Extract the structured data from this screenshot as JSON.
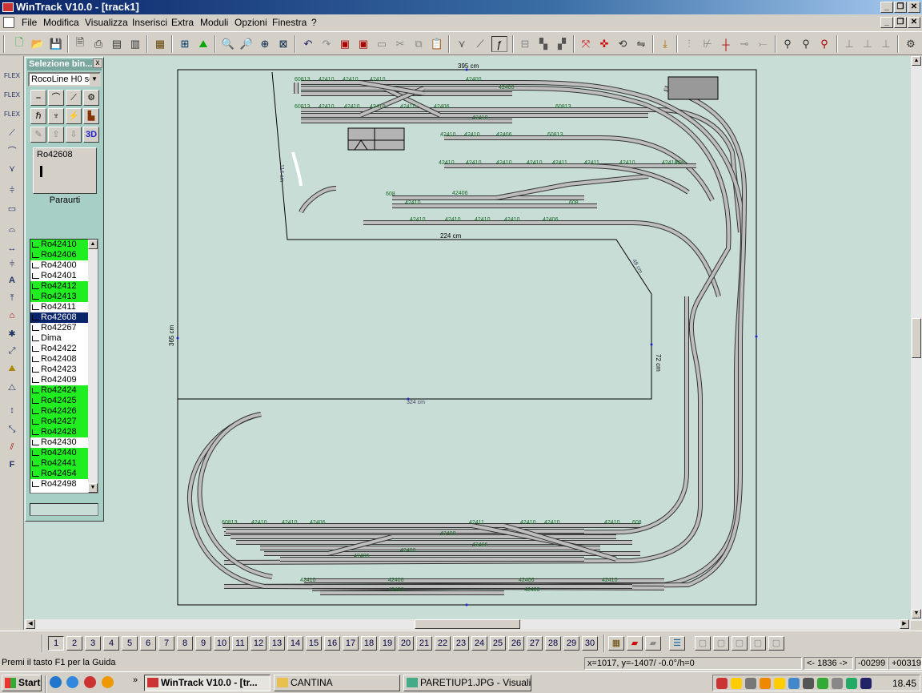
{
  "window": {
    "title": "WinTrack  V10.0 - [track1]",
    "menu": [
      "File",
      "Modifica",
      "Visualizza",
      "Inserisci",
      "Extra",
      "Moduli",
      "Opzioni",
      "Finestra",
      "?"
    ]
  },
  "selector_panel": {
    "title": "Selezione bin...",
    "close_label": "x",
    "system": "RocoLine H0 se",
    "view_3d_label": "3D",
    "preview_code": "Ro42608",
    "preview_caption": "Paraurti",
    "parts": [
      {
        "label": "Ro42410",
        "state": "green"
      },
      {
        "label": "Ro42406",
        "state": "green"
      },
      {
        "label": "Ro42400",
        "state": "normal"
      },
      {
        "label": "Ro42401",
        "state": "normal"
      },
      {
        "label": "Ro42412",
        "state": "green"
      },
      {
        "label": "Ro42413",
        "state": "green"
      },
      {
        "label": "Ro42411",
        "state": "normal"
      },
      {
        "label": "Ro42608",
        "state": "selected"
      },
      {
        "label": "Ro42267",
        "state": "normal"
      },
      {
        "label": "Dima",
        "state": "normal"
      },
      {
        "label": "Ro42422",
        "state": "normal"
      },
      {
        "label": "Ro42408",
        "state": "normal"
      },
      {
        "label": "Ro42423",
        "state": "normal"
      },
      {
        "label": "Ro42409",
        "state": "normal"
      },
      {
        "label": "Ro42424",
        "state": "green"
      },
      {
        "label": "Ro42425",
        "state": "green"
      },
      {
        "label": "Ro42426",
        "state": "green"
      },
      {
        "label": "Ro42427",
        "state": "green"
      },
      {
        "label": "Ro42428",
        "state": "green"
      },
      {
        "label": "Ro42430",
        "state": "normal"
      },
      {
        "label": "Ro42440",
        "state": "green"
      },
      {
        "label": "Ro42441",
        "state": "green"
      },
      {
        "label": "Ro42454",
        "state": "green"
      },
      {
        "label": "Ro42498",
        "state": "normal"
      }
    ]
  },
  "drawing": {
    "dim_top": "395 cm",
    "dim_left": "365 cm",
    "dim_inner_h": "224 cm",
    "dim_inner_v": "72 cm",
    "dim_bottom_inner": "324 cm",
    "dim_small": "114 cm",
    "dim_diag": "48 cm",
    "track_labels": [
      "60813",
      "42410",
      "42410",
      "42410",
      "42400",
      "42400",
      "60813",
      "42410",
      "42410",
      "42410",
      "42410",
      "42406",
      "42410",
      "60813",
      "42410",
      "42410",
      "42406",
      "60813",
      "42410",
      "42410",
      "42410",
      "42410",
      "42411",
      "42411",
      "42410",
      "42410",
      "608",
      "608",
      "42406",
      "42410",
      "608",
      "42410",
      "42410",
      "42410",
      "42410",
      "42406",
      "60813",
      "42410",
      "42410",
      "42406",
      "42411",
      "42410",
      "42410",
      "42410",
      "608",
      "42400",
      "42406",
      "42400",
      "42406",
      "42410",
      "42406",
      "42406",
      "42410",
      "42400",
      "42400"
    ]
  },
  "layer_buttons": [
    "1",
    "2",
    "3",
    "4",
    "5",
    "6",
    "7",
    "8",
    "9",
    "10",
    "11",
    "12",
    "13",
    "14",
    "15",
    "16",
    "17",
    "18",
    "19",
    "20",
    "21",
    "22",
    "23",
    "24",
    "25",
    "26",
    "27",
    "28",
    "29",
    "30"
  ],
  "statusbar": {
    "help": "Premi il tasto F1 per la Guida",
    "coords": "x=1017, y=-1407/ -0.0°/h=0",
    "a": "<- 1836 ->",
    "b": "-00299",
    "c": "+00319"
  },
  "taskbar": {
    "start": "Start",
    "tasks": [
      "WinTrack  V10.0 - [tr...",
      "CANTINA",
      "PARETIUP1.JPG - Visuali..."
    ],
    "clock": "18.45"
  },
  "colors": {
    "canvas": "#c8ddd6",
    "panel": "#a8cfc6",
    "track_label": "#1a6a2a",
    "highlight": "#20ee20"
  }
}
